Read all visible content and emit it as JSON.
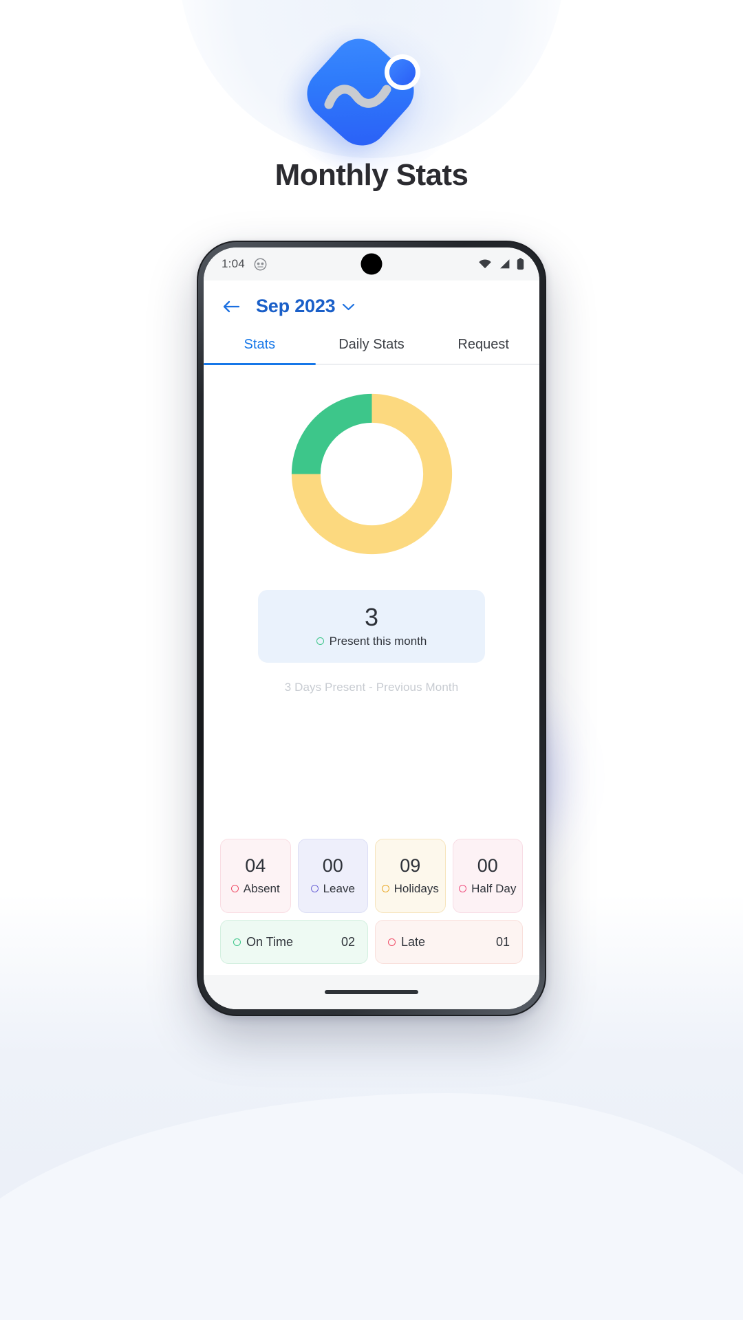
{
  "hero": {
    "title": "Monthly Stats",
    "logo_icon": "app-logo-wave-icon",
    "logo_colors": {
      "from": "#3d8bff",
      "to": "#2a5df6",
      "wave": "#c9ccd1"
    }
  },
  "phone": {
    "statusbar": {
      "time": "1:04",
      "notification_icon": "owl-app-icon",
      "wifi_icon": "wifi-icon",
      "signal_icon": "cellular-signal-icon",
      "battery_icon": "battery-full-icon"
    },
    "gesture_bar": "home-gesture-bar"
  },
  "header": {
    "back_icon": "back-arrow-icon",
    "month": "Sep 2023",
    "chevron_icon": "chevron-down-icon",
    "accent": "#1a5fc8"
  },
  "tabs": [
    {
      "label": "Stats",
      "active": true
    },
    {
      "label": "Daily Stats",
      "active": false
    },
    {
      "label": "Request",
      "active": false
    }
  ],
  "present_card": {
    "value": "3",
    "label": "Present this month",
    "bullet_color": "#3dc68a",
    "background": "#eaf2fc"
  },
  "previous_note": "3 Days Present - Previous Month",
  "tiles": [
    {
      "value": "04",
      "label": "Absent",
      "bg": "#fdf3f5",
      "border": "#f9dde3",
      "dot": "#ef4e68"
    },
    {
      "value": "00",
      "label": "Leave",
      "bg": "#eeeffb",
      "border": "#dcdef5",
      "dot": "#6b63d6"
    },
    {
      "value": "09",
      "label": "Holidays",
      "bg": "#fdf8ec",
      "border": "#f6e4bd",
      "dot": "#e9a826"
    },
    {
      "value": "00",
      "label": "Half Day",
      "bg": "#fdf2f5",
      "border": "#f8dde5",
      "dot": "#ef4e7e"
    }
  ],
  "wide_tiles": [
    {
      "label": "On Time",
      "value": "02",
      "bg": "#eefaf3",
      "border": "#d4f0e0",
      "dot": "#3dc68a"
    },
    {
      "label": "Late",
      "value": "01",
      "bg": "#fdf4f2",
      "border": "#f9e0dc",
      "dot": "#ef4e68"
    }
  ],
  "chart_data": {
    "type": "pie",
    "title": "Monthly attendance donut",
    "categories": [
      "Holidays",
      "Present"
    ],
    "values": [
      9,
      3
    ],
    "colors": [
      "#fcd97f",
      "#3dc68a"
    ],
    "donut": true,
    "inner_radius_ratio": 0.64,
    "start_angle_deg": -90,
    "legend": "none",
    "grid": false
  }
}
